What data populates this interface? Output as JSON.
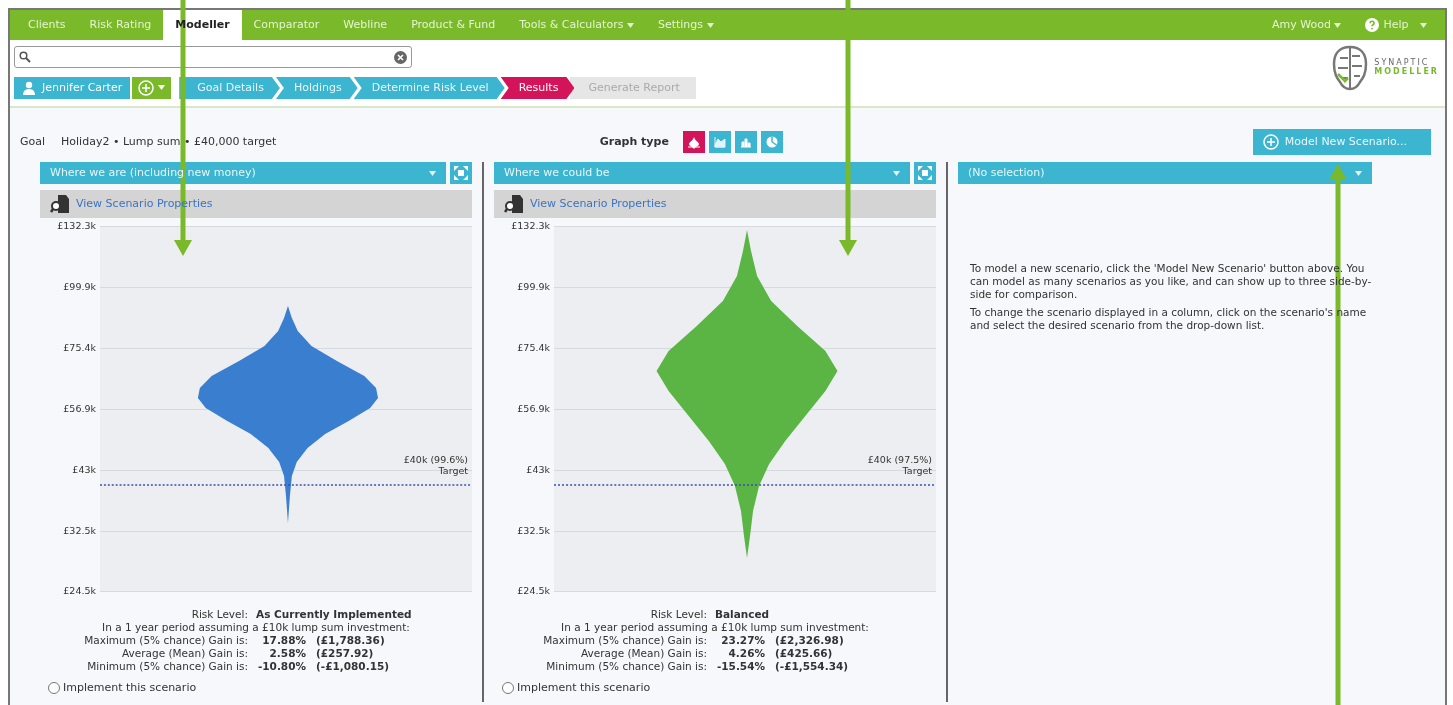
{
  "nav": {
    "tabs": [
      {
        "label": "Clients",
        "selected": false,
        "dropdown": false
      },
      {
        "label": "Risk Rating",
        "selected": false,
        "dropdown": false
      },
      {
        "label": "Modeller",
        "selected": true,
        "dropdown": false
      },
      {
        "label": "Comparator",
        "selected": false,
        "dropdown": false
      },
      {
        "label": "Webline",
        "selected": false,
        "dropdown": false
      },
      {
        "label": "Product & Fund",
        "selected": false,
        "dropdown": false
      },
      {
        "label": "Tools & Calculators",
        "selected": false,
        "dropdown": true
      },
      {
        "label": "Settings",
        "selected": false,
        "dropdown": true
      }
    ],
    "user": "Amy Wood",
    "help": "Help"
  },
  "client": {
    "name": "Jennifer Carter"
  },
  "steps": [
    {
      "label": "Goal Details",
      "selected": false,
      "disabled": false
    },
    {
      "label": "Holdings",
      "selected": false,
      "disabled": false
    },
    {
      "label": "Determine Risk Level",
      "selected": false,
      "disabled": false
    },
    {
      "label": "Results",
      "selected": true,
      "disabled": false
    },
    {
      "label": "Generate Report",
      "selected": false,
      "disabled": true
    }
  ],
  "logo": {
    "line1": "SYNAPTIC",
    "line2": "MODELLER"
  },
  "goal": {
    "label": "Goal",
    "value": "Holiday2 • Lump sum • £40,000 target"
  },
  "graph_type": {
    "label": "Graph type",
    "options": [
      {
        "kind": "violin",
        "selected": true
      },
      {
        "kind": "area",
        "selected": false
      },
      {
        "kind": "bar",
        "selected": false
      },
      {
        "kind": "pie",
        "selected": false
      }
    ]
  },
  "model_button": "Model New Scenario...",
  "columns": [
    {
      "scenario": "Where we are (including new money)",
      "props_link": "View Scenario Properties",
      "chart": {
        "color": "#3a7fcf",
        "y_axis_labels": [
          "£132.3k",
          "£99.9k",
          "£75.4k",
          "£56.9k",
          "£43k",
          "£32.5k",
          "£24.5k"
        ],
        "target_label": "£40k (99.6%)",
        "target_caption": "Target"
      },
      "summary": {
        "risk_label": "Risk Level:",
        "risk_value": "As Currently Implemented",
        "intro": "In a 1 year period assuming a £10k lump sum investment:",
        "rows": [
          {
            "label": "Maximum (5% chance) Gain is:",
            "pct": "17.88%",
            "amount": "(£1,788.36)"
          },
          {
            "label": "Average (Mean) Gain is:",
            "pct": "2.58%",
            "amount": "(£257.92)"
          },
          {
            "label": "Minimum (5% chance) Gain is:",
            "pct": "-10.80%",
            "amount": "(-£1,080.15)"
          }
        ]
      },
      "implement": {
        "label": "Implement this scenario",
        "selected": false
      }
    },
    {
      "scenario": "Where we could be",
      "props_link": "View Scenario Properties",
      "chart": {
        "color": "#5ab545",
        "y_axis_labels": [
          "£132.3k",
          "£99.9k",
          "£75.4k",
          "£56.9k",
          "£43k",
          "£32.5k",
          "£24.5k"
        ],
        "target_label": "£40k (97.5%)",
        "target_caption": "Target"
      },
      "summary": {
        "risk_label": "Risk Level:",
        "risk_value": "Balanced",
        "intro": "In a 1 year period assuming a £10k lump sum investment:",
        "rows": [
          {
            "label": "Maximum (5% chance) Gain is:",
            "pct": "23.27%",
            "amount": "(£2,326.98)"
          },
          {
            "label": "Average (Mean) Gain is:",
            "pct": "4.26%",
            "amount": "(£425.66)"
          },
          {
            "label": "Minimum (5% chance) Gain is:",
            "pct": "-15.54%",
            "amount": "(-£1,554.34)"
          }
        ]
      },
      "implement": {
        "label": "Implement this scenario",
        "selected": false
      }
    }
  ],
  "empty_column": {
    "scenario": "(No selection)",
    "help": [
      "To model a new scenario, click the 'Model New Scenario' button above. You can model as many scenarios as you like, and can show up to three side-by-side for comparison.",
      "To change the scenario displayed in a column, click on the scenario's name and select the desired scenario from the drop-down list."
    ]
  }
}
